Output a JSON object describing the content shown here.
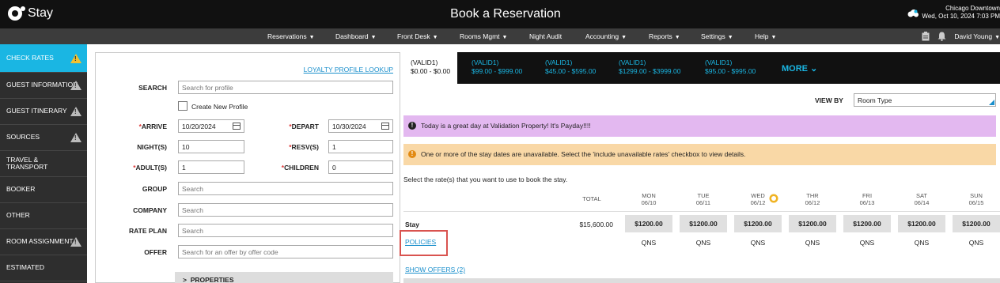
{
  "app": {
    "logo_text": "Stay",
    "title": "Book a Reservation"
  },
  "property": {
    "name": "Chicago Downtown",
    "datetime": "Wed, Oct 10, 2024 7:03 PM"
  },
  "nav": {
    "items": [
      {
        "label": "Reservations",
        "has_menu": true
      },
      {
        "label": "Dashboard",
        "has_menu": true
      },
      {
        "label": "Front Desk",
        "has_menu": true
      },
      {
        "label": "Rooms Mgmt",
        "has_menu": true
      },
      {
        "label": "Night Audit",
        "has_menu": false
      },
      {
        "label": "Accounting",
        "has_menu": true
      },
      {
        "label": "Reports",
        "has_menu": true
      },
      {
        "label": "Settings",
        "has_menu": true
      },
      {
        "label": "Help",
        "has_menu": true
      }
    ],
    "user": "David Young"
  },
  "sidebar": {
    "items": [
      {
        "label": "CHECK RATES",
        "warning": true,
        "active": true
      },
      {
        "label": "GUEST INFORMATION",
        "warning": true
      },
      {
        "label": "GUEST ITINERARY",
        "warning": true
      },
      {
        "label": "SOURCES",
        "warning": true
      },
      {
        "label": "TRAVEL & TRANSPORT",
        "warning": false
      },
      {
        "label": "BOOKER",
        "warning": false
      },
      {
        "label": "OTHER",
        "warning": false
      },
      {
        "label": "ROOM ASSIGNMENT",
        "warning": true
      },
      {
        "label": "ESTIMATED",
        "warning": false
      }
    ]
  },
  "form": {
    "loyalty_link": "LOYALTY PROFILE LOOKUP",
    "search": {
      "label": "SEARCH",
      "placeholder": "Search for profile"
    },
    "create_profile": "Create New Profile",
    "arrive": {
      "label": "ARRIVE",
      "value": "10/20/2024"
    },
    "depart": {
      "label": "DEPART",
      "value": "10/30/2024"
    },
    "nights": {
      "label": "NIGHT(S)",
      "value": "10"
    },
    "resv": {
      "label": "RESV(S)",
      "value": "1"
    },
    "adults": {
      "label": "ADULT(S)",
      "value": "1"
    },
    "children": {
      "label": "CHILDREN",
      "value": "0"
    },
    "group": {
      "label": "GROUP",
      "placeholder": "Search"
    },
    "company": {
      "label": "COMPANY",
      "placeholder": "Search"
    },
    "rate_plan": {
      "label": "RATE PLAN",
      "placeholder": "Search"
    },
    "offer": {
      "label": "OFFER",
      "placeholder": "Search for an offer by offer code"
    },
    "properties_label": "PROPERTIES"
  },
  "rates": {
    "tabs": [
      {
        "name": "(VALID1)",
        "range": "$0.00 - $0.00",
        "active": true
      },
      {
        "name": "(VALID1)",
        "range": "$99.00 - $999.00"
      },
      {
        "name": "(VALID1)",
        "range": "$45.00 - $595.00"
      },
      {
        "name": "(VALID1)",
        "range": "$1299.00 - $3999.00"
      },
      {
        "name": "(VALID1)",
        "range": "$95.00 - $995.00"
      }
    ],
    "more_label": "MORE",
    "view_by_label": "VIEW BY",
    "view_by_value": "Room Type",
    "alert_info": "Today is a great day at Validation Property! It's Payday!!!!",
    "alert_warning": "One or more of the stay dates are unavailable. Select the 'include unavailable rates' checkbox to view details.",
    "instruction": "Select the rate(s) that you want to use to book the stay.",
    "total_header": "TOTAL",
    "days": [
      {
        "day": "MON",
        "date": "06/10"
      },
      {
        "day": "TUE",
        "date": "06/11"
      },
      {
        "day": "WED",
        "date": "06/12",
        "special": true
      },
      {
        "day": "THR",
        "date": "06/12"
      },
      {
        "day": "FRI",
        "date": "06/13"
      },
      {
        "day": "SAT",
        "date": "06/14"
      },
      {
        "day": "SUN",
        "date": "06/15"
      }
    ],
    "stay_label": "Stay",
    "stay_total": "$15,600.00",
    "daily_rates": [
      "$1200.00",
      "$1200.00",
      "$1200.00",
      "$1200.00",
      "$1200.00",
      "$1200.00",
      "$1200.00"
    ],
    "availability": [
      "QNS",
      "QNS",
      "QNS",
      "QNS",
      "QNS",
      "QNS",
      "QNS"
    ],
    "policies_label": "POLICIES",
    "show_offers_label": "SHOW OFFERS (2)"
  }
}
